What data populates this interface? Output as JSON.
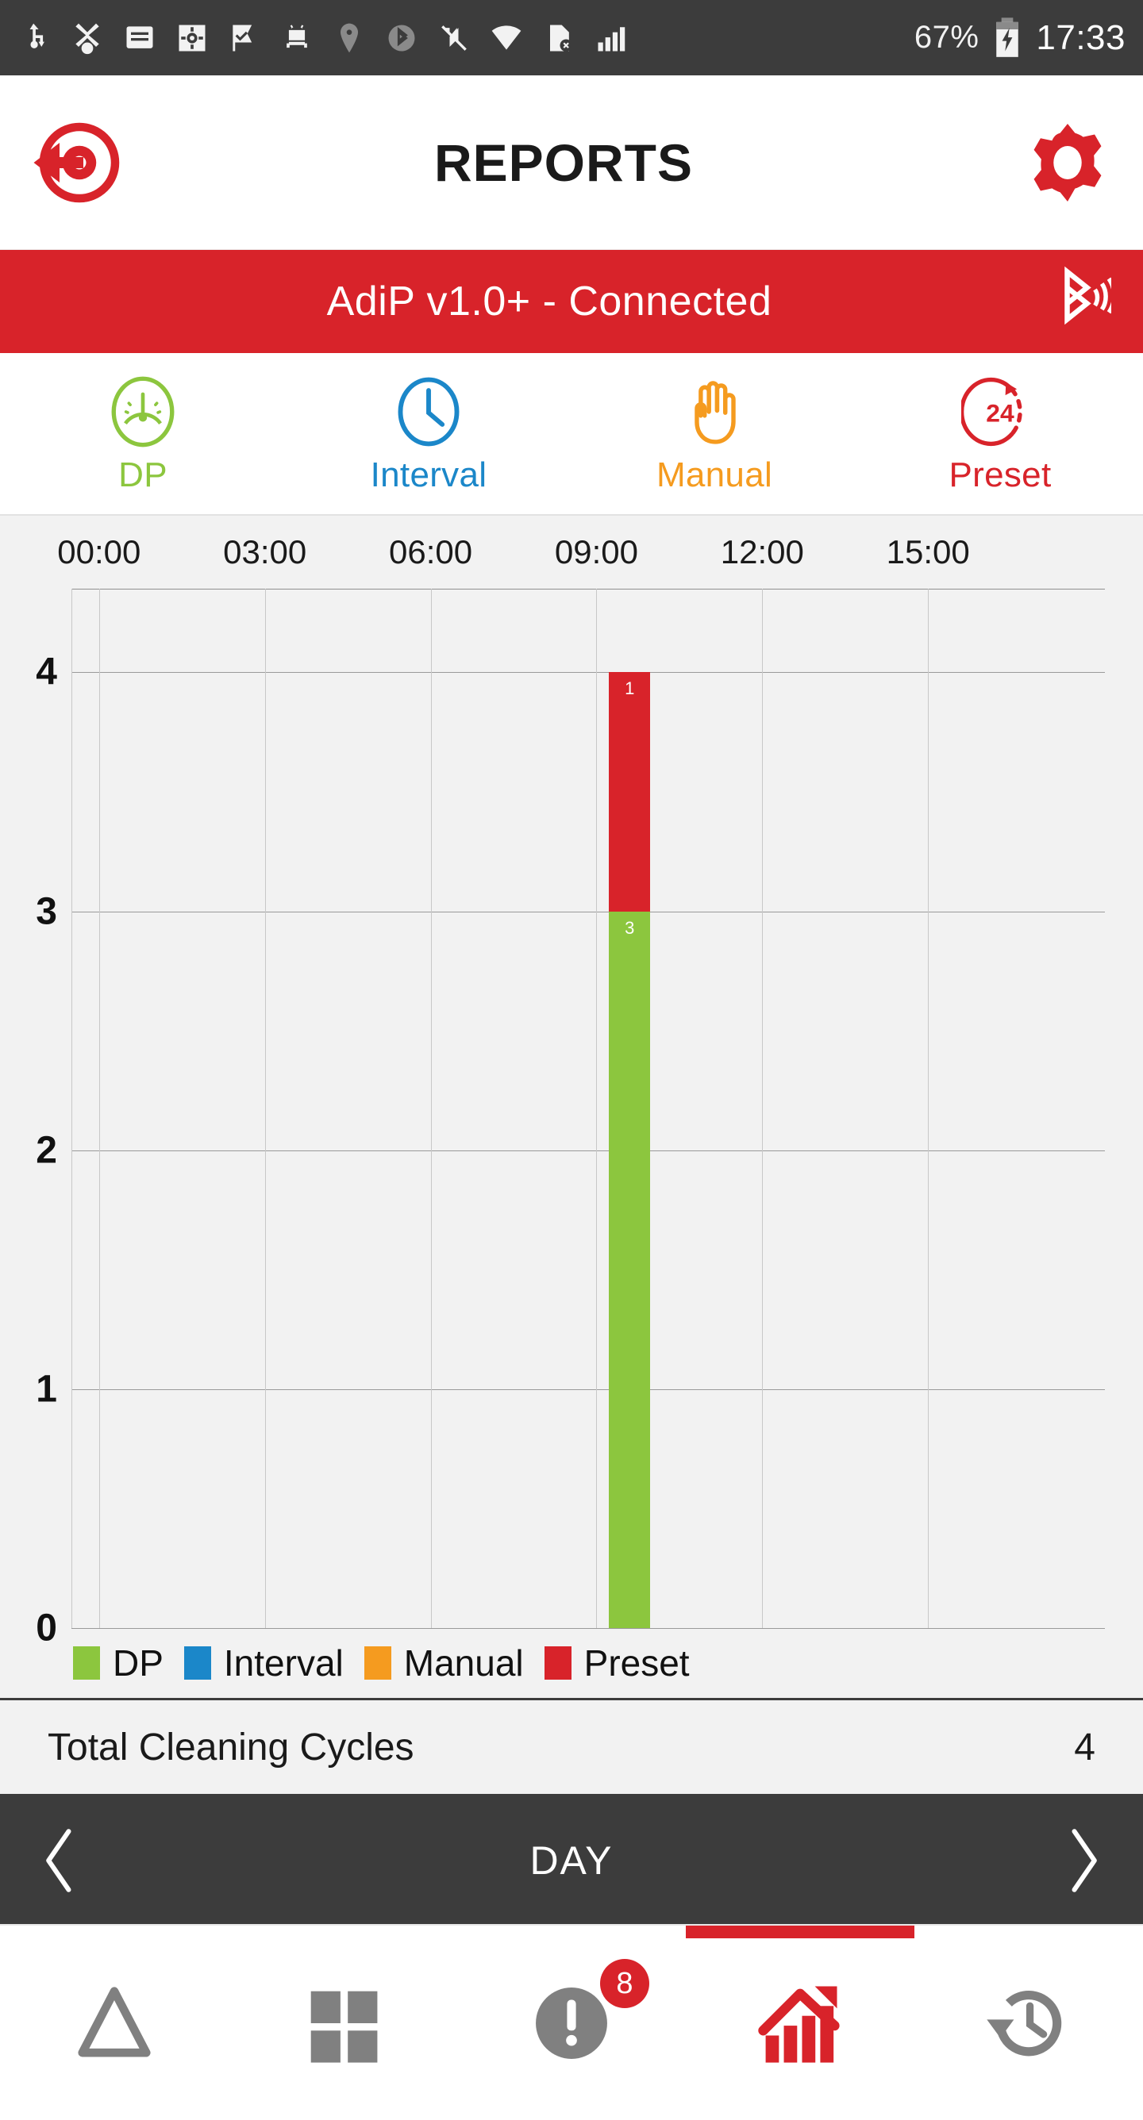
{
  "statusbar": {
    "battery_percent": "67%",
    "time": "17:33",
    "icons_left": [
      "usb-icon",
      "vpn-key-icon",
      "message-icon",
      "settings-update-icon",
      "checkmark-flag-icon",
      "android-icon",
      "location-icon",
      "bluetooth-icon",
      "mute-icon",
      "wifi-icon",
      "sd-card-error-icon",
      "signal-bars-icon"
    ],
    "battery_icon": "battery-charging-icon"
  },
  "header": {
    "title": "REPORTS",
    "back_icon": "back-arrow-target-icon",
    "settings_icon": "gear-icon"
  },
  "connection": {
    "text": "AdiP v1.0+ - Connected",
    "icon": "bluetooth-connected-icon",
    "bg_color": "#d8232a"
  },
  "modes": [
    {
      "label": "DP",
      "icon": "gauge-icon",
      "color": "#8cc63e"
    },
    {
      "label": "Interval",
      "icon": "clock-icon",
      "color": "#1b87c9"
    },
    {
      "label": "Manual",
      "icon": "hand-icon",
      "color": "#f59b1f"
    },
    {
      "label": "Preset",
      "icon": "24-hour-cycle-icon",
      "color": "#d8232a"
    }
  ],
  "chart_data": {
    "type": "bar",
    "stacked": true,
    "title": "",
    "xlabel": "",
    "ylabel": "",
    "grid": true,
    "legend_position": "bottom-left",
    "xtick_labels": [
      "00:00",
      "03:00",
      "06:00",
      "09:00",
      "12:00",
      "15:00"
    ],
    "xtick_hours": [
      0,
      3,
      6,
      9,
      12,
      15
    ],
    "x_range_hours": [
      -0.5,
      18.2
    ],
    "ytick_labels": [
      "0",
      "1",
      "2",
      "3",
      "4"
    ],
    "ylim": [
      0,
      4.35
    ],
    "series": [
      {
        "name": "DP",
        "color": "#8cc63e",
        "values": [
          3
        ]
      },
      {
        "name": "Interval",
        "color": "#1b87c9",
        "values": [
          0
        ]
      },
      {
        "name": "Manual",
        "color": "#f59b1f",
        "values": [
          0
        ]
      },
      {
        "name": "Preset",
        "color": "#d8232a",
        "values": [
          1
        ]
      }
    ],
    "bars": [
      {
        "x_hour": 9.6,
        "segments": [
          {
            "series": "DP",
            "value": 3,
            "label": "3",
            "color": "#8cc63e"
          },
          {
            "series": "Preset",
            "value": 1,
            "label": "1",
            "color": "#d8232a"
          }
        ]
      }
    ],
    "legend": [
      {
        "label": "DP",
        "color": "#8cc63e"
      },
      {
        "label": "Interval",
        "color": "#1b87c9"
      },
      {
        "label": "Manual",
        "color": "#f59b1f"
      },
      {
        "label": "Preset",
        "color": "#d8232a"
      }
    ]
  },
  "total": {
    "label": "Total Cleaning Cycles",
    "value": "4"
  },
  "period": {
    "label": "DAY",
    "prev_icon": "chevron-left-icon",
    "next_icon": "chevron-right-icon"
  },
  "bottomnav": [
    {
      "name": "delta",
      "icon": "triangle-icon",
      "active": false,
      "badge": ""
    },
    {
      "name": "modules",
      "icon": "grid-icon",
      "active": false,
      "badge": ""
    },
    {
      "name": "alerts",
      "icon": "alert-icon",
      "active": false,
      "badge": "8"
    },
    {
      "name": "reports",
      "icon": "bar-chart-up-icon",
      "active": true,
      "badge": ""
    },
    {
      "name": "history",
      "icon": "history-icon",
      "active": false,
      "badge": ""
    }
  ]
}
